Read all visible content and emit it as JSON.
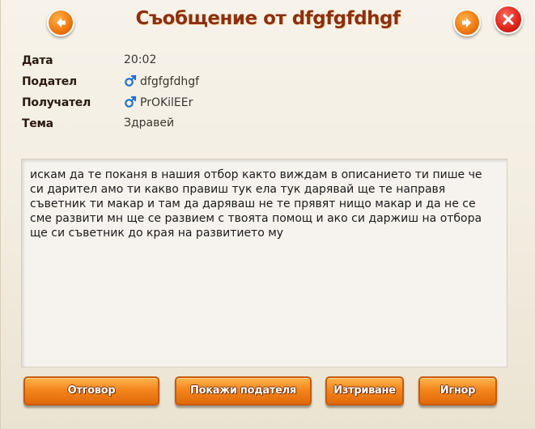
{
  "header": {
    "title": "Съобщение от dfgfgfdhgf"
  },
  "meta": {
    "date_label": "Дата",
    "date_value": "20:02",
    "sender_label": "Подател",
    "sender_value": "dfgfgfdhgf",
    "recipient_label": "Получател",
    "recipient_value": "PrOKilEEr",
    "subject_label": "Тема",
    "subject_value": "Здравей"
  },
  "message": {
    "body": "искам да те поканя в нашия отбор както виждам в описанието ти пише че си дарител амо ти какво правиш тук ела тук дарявай ще те направя съветник ти макар и там да даряваш не те прявят нищо макар и да не се сме развити мн ще се развием с твоята помощ и ако си даржиш на отбора ще си съветник до края на развитието му"
  },
  "buttons": {
    "reply": "Отговор",
    "show_sender": "Покажи подателя",
    "delete": "Изтриване",
    "ignore": "Игнор"
  },
  "colors": {
    "accent_orange": "#f3861c",
    "title_red": "#8b2f12",
    "close_red": "#e0271c",
    "male_blue": "#1e6fd0"
  },
  "icons": {
    "prev": "arrow-left-icon",
    "next": "arrow-right-icon",
    "close": "close-icon",
    "gender": "male-icon"
  }
}
